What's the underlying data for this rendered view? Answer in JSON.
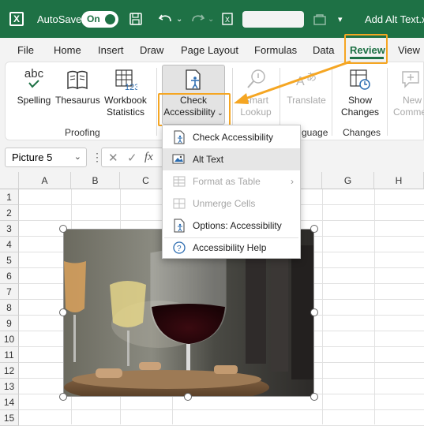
{
  "titlebar": {
    "autosave_label": "AutoSave",
    "toggle_label": "On",
    "doc_title": "Add Alt Text.xl"
  },
  "tabs": [
    {
      "label": "File"
    },
    {
      "label": "Home"
    },
    {
      "label": "Insert"
    },
    {
      "label": "Draw"
    },
    {
      "label": "Page Layout"
    },
    {
      "label": "Formulas"
    },
    {
      "label": "Data"
    },
    {
      "label": "Review"
    },
    {
      "label": "View"
    }
  ],
  "ribbon": {
    "proofing": {
      "group_label": "Proofing",
      "spelling": "Spelling",
      "spelling_icon_text": "abc",
      "thesaurus": "Thesaurus",
      "workbook_line1": "Workbook",
      "workbook_line2": "Statistics",
      "workbook_icon_text": "123"
    },
    "accessibility": {
      "line1": "Check",
      "line2": "Accessibility"
    },
    "insights": {
      "smart_line1": "Smart",
      "smart_line2": "Lookup"
    },
    "language": {
      "translate": "Translate",
      "group_label_partial": "guage"
    },
    "changes": {
      "show_line1": "Show",
      "show_line2": "Changes",
      "group_label": "Changes",
      "new_comment_line1": "New",
      "new_comment_line2": "Comme"
    }
  },
  "formula_bar": {
    "name_box": "Picture 5",
    "fx": "fx"
  },
  "columns": [
    "A",
    "B",
    "C",
    "",
    "G",
    "H"
  ],
  "rows": [
    "1",
    "2",
    "3",
    "4",
    "5",
    "6",
    "7",
    "8",
    "9",
    "10",
    "11",
    "12",
    "13",
    "14",
    "15"
  ],
  "menu": {
    "items": [
      {
        "label": "Check Accessibility",
        "state": "normal"
      },
      {
        "label": "Alt Text",
        "state": "hover"
      },
      {
        "label": "Format as Table",
        "state": "disabled"
      },
      {
        "label": "Unmerge Cells",
        "state": "disabled"
      },
      {
        "label": "Options: Accessibility",
        "state": "normal"
      },
      {
        "label": "Accessibility Help",
        "state": "normal"
      }
    ]
  },
  "colors": {
    "excel_green": "#1e7145",
    "highlight_orange": "#f5a623"
  }
}
